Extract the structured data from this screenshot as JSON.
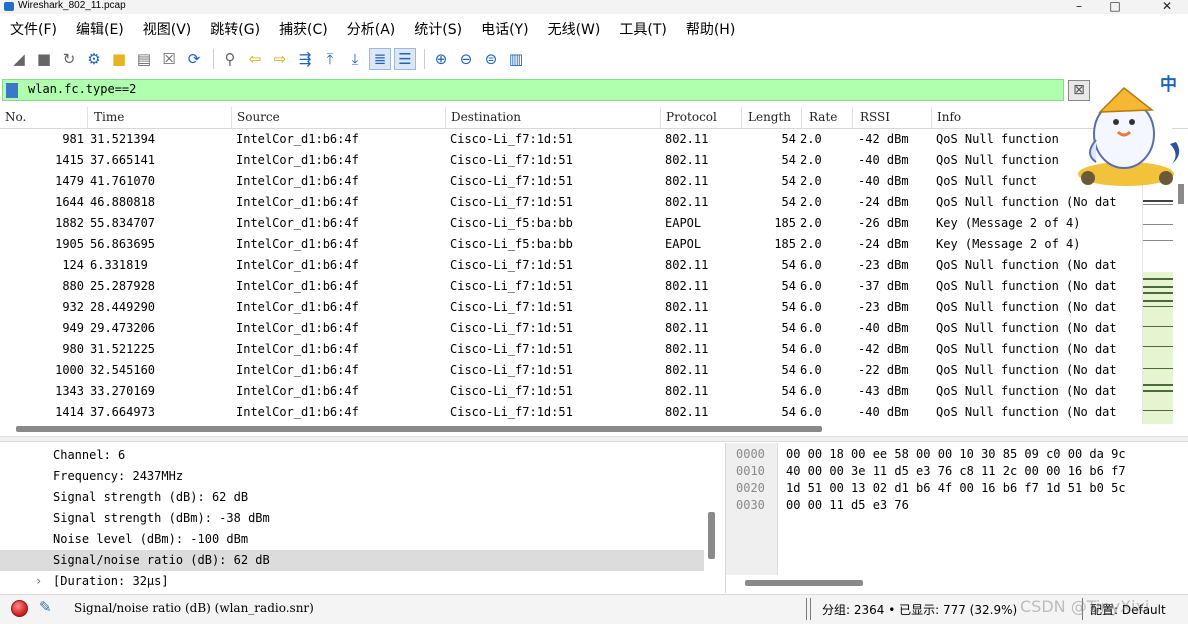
{
  "window": {
    "title": "Wireshark_802_11.pcap",
    "controls": [
      "–",
      "□",
      "✕"
    ]
  },
  "menu": [
    "文件(F)",
    "编辑(E)",
    "视图(V)",
    "跳转(G)",
    "捕获(C)",
    "分析(A)",
    "统计(S)",
    "电话(Y)",
    "无线(W)",
    "工具(T)",
    "帮助(H)"
  ],
  "filter": {
    "value": "wlan.fc.type==2"
  },
  "packet_list": {
    "columns": [
      "No.",
      "Time",
      "Source",
      "Destination",
      "Protocol",
      "Length",
      "Rate",
      "RSSI",
      "Info"
    ],
    "rows": [
      {
        "no": "981",
        "time": "31.521394",
        "src": "IntelCor_d1:b6:4f",
        "dst": "Cisco-Li_f7:1d:51",
        "proto": "802.11",
        "len": "54",
        "rate": "2.0",
        "rssi": "-42 dBm",
        "info": "QoS Null function"
      },
      {
        "no": "1415",
        "time": "37.665141",
        "src": "IntelCor_d1:b6:4f",
        "dst": "Cisco-Li_f7:1d:51",
        "proto": "802.11",
        "len": "54",
        "rate": "2.0",
        "rssi": "-40 dBm",
        "info": "QoS Null function"
      },
      {
        "no": "1479",
        "time": "41.761070",
        "src": "IntelCor_d1:b6:4f",
        "dst": "Cisco-Li_f7:1d:51",
        "proto": "802.11",
        "len": "54",
        "rate": "2.0",
        "rssi": "-40 dBm",
        "info": "QoS Null funct"
      },
      {
        "no": "1644",
        "time": "46.880818",
        "src": "IntelCor_d1:b6:4f",
        "dst": "Cisco-Li_f7:1d:51",
        "proto": "802.11",
        "len": "54",
        "rate": "2.0",
        "rssi": "-24 dBm",
        "info": "QoS Null function (No dat"
      },
      {
        "no": "1882",
        "time": "55.834707",
        "src": "IntelCor_d1:b6:4f",
        "dst": "Cisco-Li_f5:ba:bb",
        "proto": "EAPOL",
        "len": "185",
        "rate": "2.0",
        "rssi": "-26 dBm",
        "info": "Key (Message 2 of 4)"
      },
      {
        "no": "1905",
        "time": "56.863695",
        "src": "IntelCor_d1:b6:4f",
        "dst": "Cisco-Li_f5:ba:bb",
        "proto": "EAPOL",
        "len": "185",
        "rate": "2.0",
        "rssi": "-24 dBm",
        "info": "Key (Message 2 of 4)"
      },
      {
        "no": "124",
        "time": "6.331819",
        "src": "IntelCor_d1:b6:4f",
        "dst": "Cisco-Li_f7:1d:51",
        "proto": "802.11",
        "len": "54",
        "rate": "6.0",
        "rssi": "-23 dBm",
        "info": "QoS Null function (No dat"
      },
      {
        "no": "880",
        "time": "25.287928",
        "src": "IntelCor_d1:b6:4f",
        "dst": "Cisco-Li_f7:1d:51",
        "proto": "802.11",
        "len": "54",
        "rate": "6.0",
        "rssi": "-37 dBm",
        "info": "QoS Null function (No dat"
      },
      {
        "no": "932",
        "time": "28.449290",
        "src": "IntelCor_d1:b6:4f",
        "dst": "Cisco-Li_f7:1d:51",
        "proto": "802.11",
        "len": "54",
        "rate": "6.0",
        "rssi": "-23 dBm",
        "info": "QoS Null function (No dat"
      },
      {
        "no": "949",
        "time": "29.473206",
        "src": "IntelCor_d1:b6:4f",
        "dst": "Cisco-Li_f7:1d:51",
        "proto": "802.11",
        "len": "54",
        "rate": "6.0",
        "rssi": "-40 dBm",
        "info": "QoS Null function (No dat"
      },
      {
        "no": "980",
        "time": "31.521225",
        "src": "IntelCor_d1:b6:4f",
        "dst": "Cisco-Li_f7:1d:51",
        "proto": "802.11",
        "len": "54",
        "rate": "6.0",
        "rssi": "-42 dBm",
        "info": "QoS Null function (No dat"
      },
      {
        "no": "1000",
        "time": "32.545160",
        "src": "IntelCor_d1:b6:4f",
        "dst": "Cisco-Li_f7:1d:51",
        "proto": "802.11",
        "len": "54",
        "rate": "6.0",
        "rssi": "-22 dBm",
        "info": "QoS Null function (No dat"
      },
      {
        "no": "1343",
        "time": "33.270169",
        "src": "IntelCor_d1:b6:4f",
        "dst": "Cisco-Li_f7:1d:51",
        "proto": "802.11",
        "len": "54",
        "rate": "6.0",
        "rssi": "-43 dBm",
        "info": "QoS Null function (No dat"
      },
      {
        "no": "1414",
        "time": "37.664973",
        "src": "IntelCor_d1:b6:4f",
        "dst": "Cisco-Li_f7:1d:51",
        "proto": "802.11",
        "len": "54",
        "rate": "6.0",
        "rssi": "-40 dBm",
        "info": "QoS Null function (No dat"
      }
    ]
  },
  "details": {
    "lines": [
      "Channel: 6",
      "Frequency: 2437MHz",
      "Signal strength (dB): 62 dB",
      "Signal strength (dBm): -38 dBm",
      "Noise level (dBm): -100 dBm",
      "Signal/noise ratio (dB): 62 dB",
      "[Duration: 32µs]"
    ],
    "selected_index": 5,
    "expandable_index": 6
  },
  "hex": {
    "rows": [
      {
        "offset": "0000",
        "bytes": "00 00 18 00 ee 58 00 00  10 30 85 09 c0 00 da 9c"
      },
      {
        "offset": "0010",
        "bytes": "40 00 00 3e 11 d5 e3 76  c8 11 2c 00 00 16 b6 f7"
      },
      {
        "offset": "0020",
        "bytes": "1d 51 00 13 02 d1 b6 4f  00 16 b6 f7 1d 51 b0 5c"
      },
      {
        "offset": "0030",
        "bytes": "00 00 11 d5 e3 76"
      }
    ]
  },
  "status": {
    "field": "Signal/noise ratio (dB) (wlan_radio.snr)",
    "stats": "分组: 2364 • 已显示: 777 (32.9%)",
    "profile": "配置: Default",
    "watermark": "CSDN @TinyXixi"
  },
  "ime": {
    "lang": "中"
  },
  "colors": {
    "filter_valid_bg": "#afffaf",
    "selected_row_bg": "#dcdcdc",
    "accent": "#1d63b8"
  }
}
